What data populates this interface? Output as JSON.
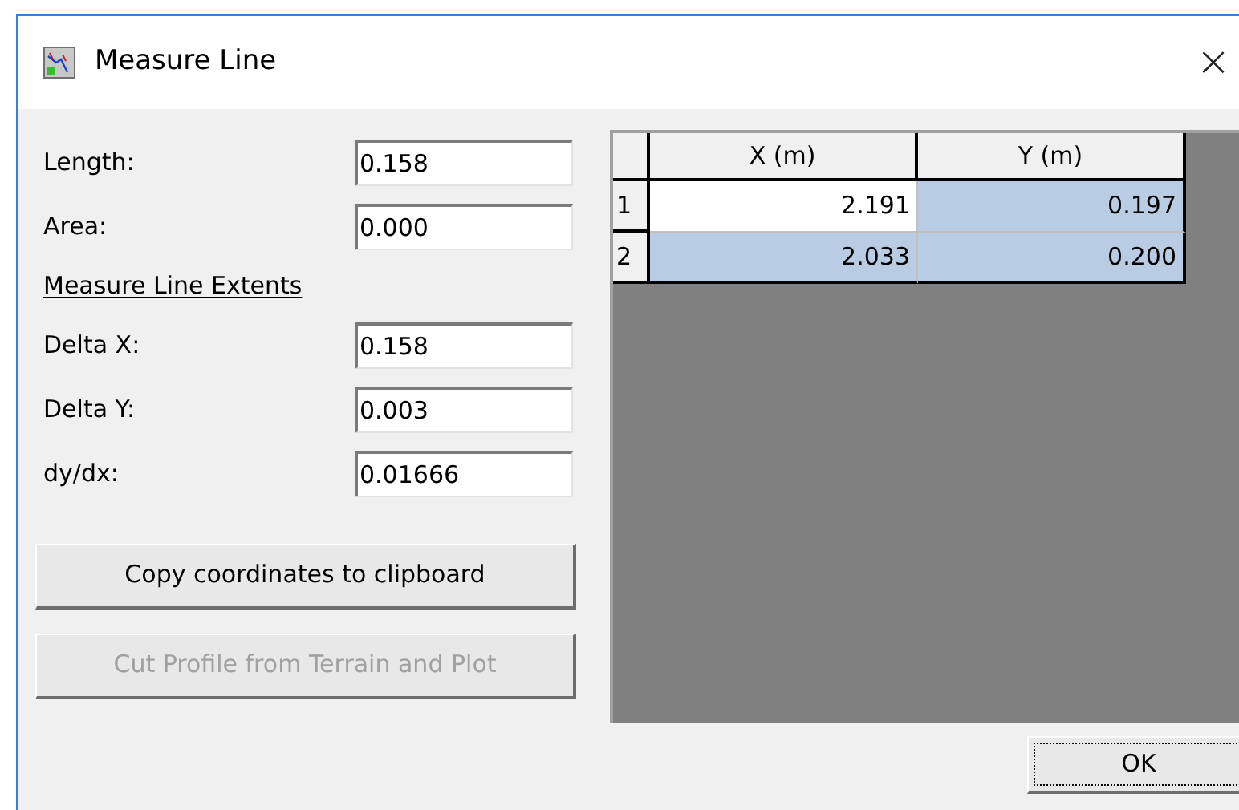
{
  "window": {
    "title": "Measure Line",
    "close": "×"
  },
  "fields": [
    {
      "label": "Length:",
      "value": "0.158"
    },
    {
      "label": "Area:",
      "value": "0.000"
    }
  ],
  "extents_heading": "Measure Line Extents",
  "extent_fields": [
    {
      "label": "Delta X:",
      "value": "0.158"
    },
    {
      "label": "Delta Y:",
      "value": "0.003"
    },
    {
      "label": "dy/dx:",
      "value": "0.01666"
    }
  ],
  "buttons": [
    {
      "label": "Copy coordinates to clipboard",
      "disabled": false
    },
    {
      "label": "Cut Profile from Terrain and Plot",
      "disabled": true
    }
  ],
  "table": {
    "columns": [
      "X (m)",
      "Y (m)"
    ],
    "rows": [
      {
        "number": "1",
        "cells": [
          {
            "value": "2.191",
            "selected": false
          },
          {
            "value": "0.197",
            "selected": true
          }
        ]
      },
      {
        "number": "2",
        "cells": [
          {
            "value": "2.033",
            "selected": true
          },
          {
            "value": "0.200",
            "selected": true
          }
        ]
      }
    ]
  },
  "ok_button": "OK"
}
